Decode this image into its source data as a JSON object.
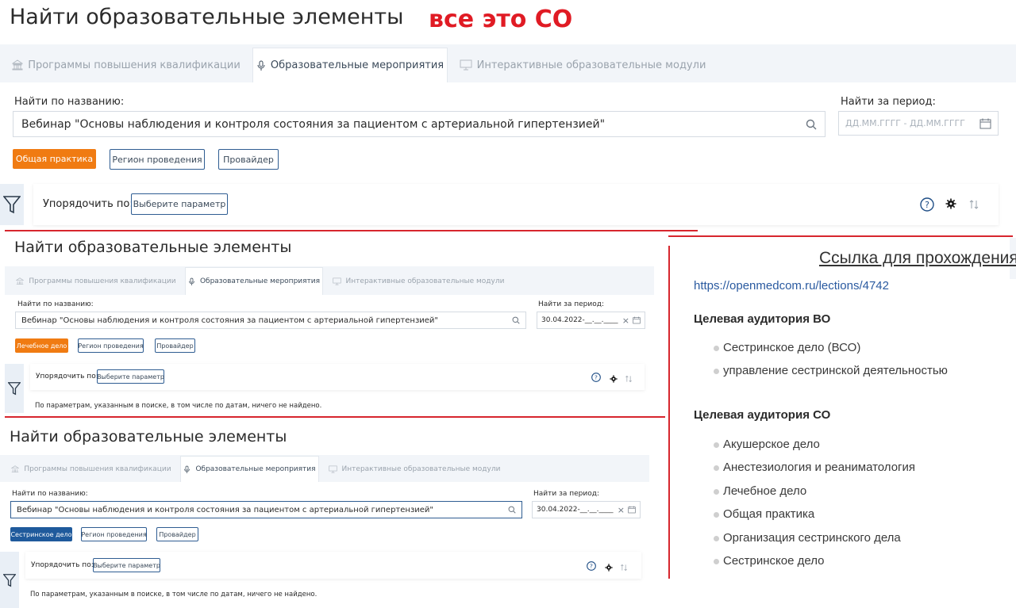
{
  "annotation": "все это СО",
  "panels": [
    {
      "title": "Найти образовательные элементы",
      "tabs": [
        "Программы повышения квалификации",
        "Образовательные мероприятия",
        "Интерактивные образовательные модули"
      ],
      "search_label": "Найти по названию:",
      "search_value": "Вебинар \"Основы наблюдения и контроля состояния за пациентом с артериальной гипертензией\"",
      "period_label": "Найти за период:",
      "period_placeholder": "ДД.ММ.ГГГГ - ДД.ММ.ГГГГ",
      "period_value": "",
      "chips": [
        "Общая практика",
        "Регион проведения",
        "Провайдер"
      ],
      "sort_label": "Упорядочить по:",
      "sort_button": "Выберите параметр"
    },
    {
      "title": "Найти образовательные элементы",
      "tabs": [
        "Программы повышения квалификации",
        "Образовательные мероприятия",
        "Интерактивные образовательные модули"
      ],
      "search_label": "Найти по названию:",
      "search_value": "Вебинар \"Основы наблюдения и контроля состояния за пациентом с артериальной гипертензией\"",
      "period_label": "Найти за период:",
      "period_value": "30.04.2022-__.__.____",
      "chips": [
        "Лечебное дело",
        "Регион проведения",
        "Провайдер"
      ],
      "sort_label": "Упорядочить по:",
      "sort_button": "Выберите параметр",
      "not_found": "По параметрам, указанным в поиске, в том числе по датам, ничего не найдено."
    },
    {
      "title": "Найти образовательные элементы",
      "tabs": [
        "Программы повышения квалификации",
        "Образовательные мероприятия",
        "Интерактивные образовательные модули"
      ],
      "search_label": "Найти по названию:",
      "search_value": "Вебинар \"Основы наблюдения и контроля состояния за пациентом с артериальной гипертензией\"",
      "period_label": "Найти за период:",
      "period_value": "30.04.2022-__.__.____",
      "chips": [
        "Сестринское дело",
        "Регион проведения",
        "Провайдер"
      ],
      "sort_label": "Упорядочить по:",
      "sort_button": "Выберите параметр",
      "not_found": "По параметрам, указанным в поиске, в том числе по датам, ничего не найдено."
    }
  ],
  "right_panel": {
    "link_title": "Ссылка для прохождения",
    "url": "https://openmedcom.ru/lections/4742",
    "vo_heading": "Целевая аудитория ВО",
    "vo_items": [
      "Сестринское дело (ВСО)",
      "управление сестринской деятельностью"
    ],
    "so_heading": "Целевая аудитория СО",
    "so_items": [
      "Акушерское дело",
      "Анестезиология и реаниматология",
      "Лечебное дело",
      "Общая практика",
      "Организация сестринского дела",
      "Сестринское дело"
    ]
  },
  "colors": {
    "annotation_red": "#e01b24",
    "orange_chip": "#f07b12",
    "blue_chip": "#1f5a9c",
    "outline_blue": "#2f5d92",
    "link_blue": "#2a5aa0",
    "panel_bg": "#f2f5f9"
  }
}
